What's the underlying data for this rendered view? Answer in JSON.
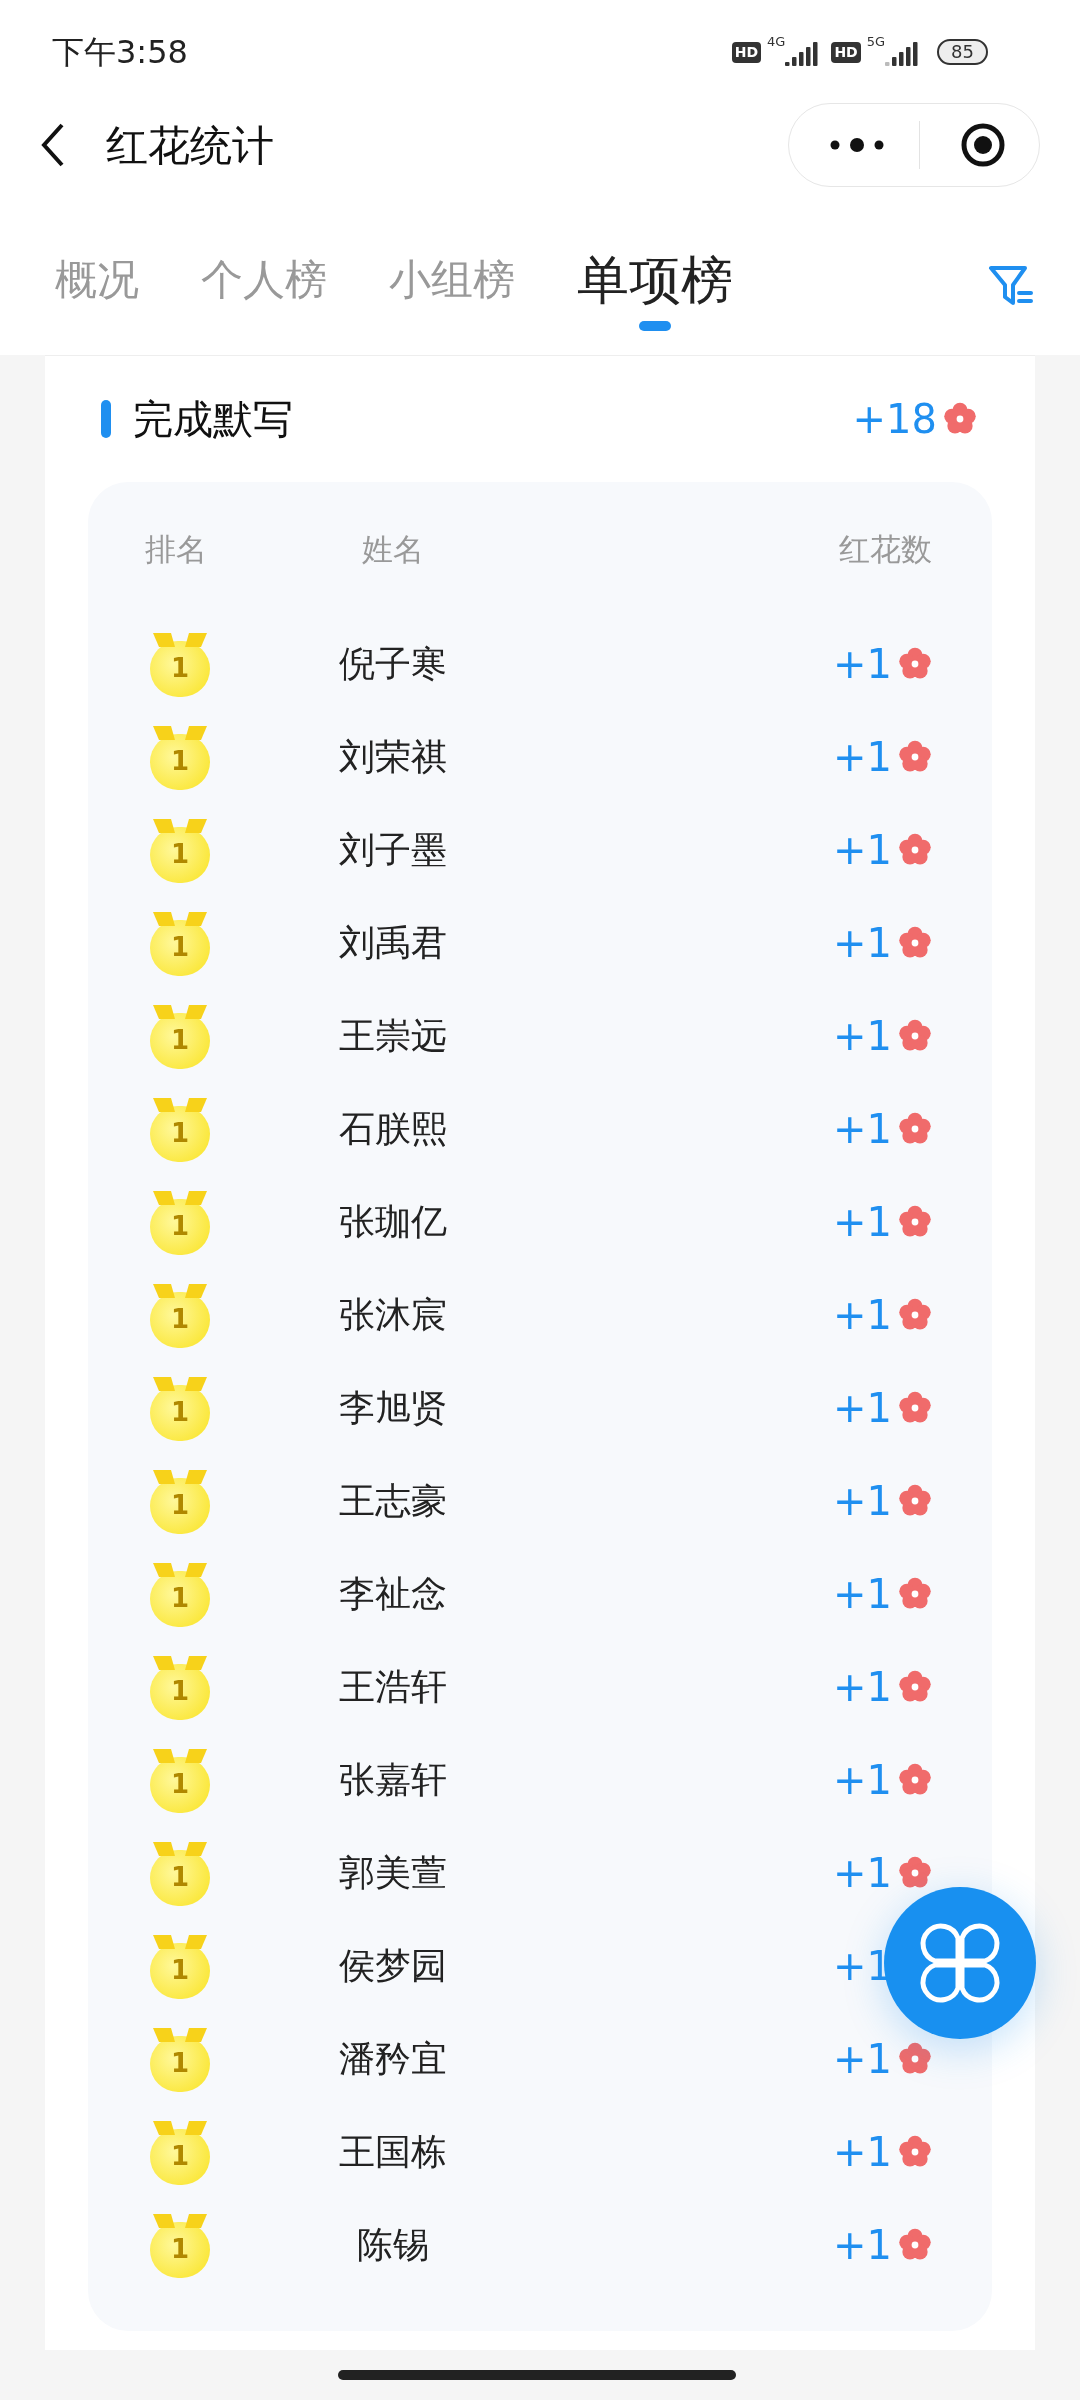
{
  "status_bar": {
    "time": "下午3:58",
    "sim1_badge": "HD",
    "sim1_network": "4G",
    "sim2_badge": "HD",
    "sim2_network": "5G",
    "battery": "85"
  },
  "nav": {
    "title": "红花统计"
  },
  "tabs": [
    {
      "label": "概况",
      "selected": false
    },
    {
      "label": "个人榜",
      "selected": false
    },
    {
      "label": "小组榜",
      "selected": false
    },
    {
      "label": "单项榜",
      "selected": true
    }
  ],
  "section": {
    "title": "完成默写",
    "total": "+18"
  },
  "table": {
    "columns": [
      "排名",
      "姓名",
      "红花数"
    ],
    "rows": [
      {
        "rank": "1",
        "name": "倪子寒",
        "count": "+1"
      },
      {
        "rank": "1",
        "name": "刘荣祺",
        "count": "+1"
      },
      {
        "rank": "1",
        "name": "刘子墨",
        "count": "+1"
      },
      {
        "rank": "1",
        "name": "刘禹君",
        "count": "+1"
      },
      {
        "rank": "1",
        "name": "王崇远",
        "count": "+1"
      },
      {
        "rank": "1",
        "name": "石朕熙",
        "count": "+1"
      },
      {
        "rank": "1",
        "name": "张珈亿",
        "count": "+1"
      },
      {
        "rank": "1",
        "name": "张沐宸",
        "count": "+1"
      },
      {
        "rank": "1",
        "name": "李旭贤",
        "count": "+1"
      },
      {
        "rank": "1",
        "name": "王志豪",
        "count": "+1"
      },
      {
        "rank": "1",
        "name": "李祉念",
        "count": "+1"
      },
      {
        "rank": "1",
        "name": "王浩轩",
        "count": "+1"
      },
      {
        "rank": "1",
        "name": "张嘉轩",
        "count": "+1"
      },
      {
        "rank": "1",
        "name": "郭美萱",
        "count": "+1"
      },
      {
        "rank": "1",
        "name": "侯梦园",
        "count": "+1"
      },
      {
        "rank": "1",
        "name": "潘矜宜",
        "count": "+1"
      },
      {
        "rank": "1",
        "name": "王国栋",
        "count": "+1"
      },
      {
        "rank": "1",
        "name": "陈锡",
        "count": "+1"
      }
    ]
  }
}
